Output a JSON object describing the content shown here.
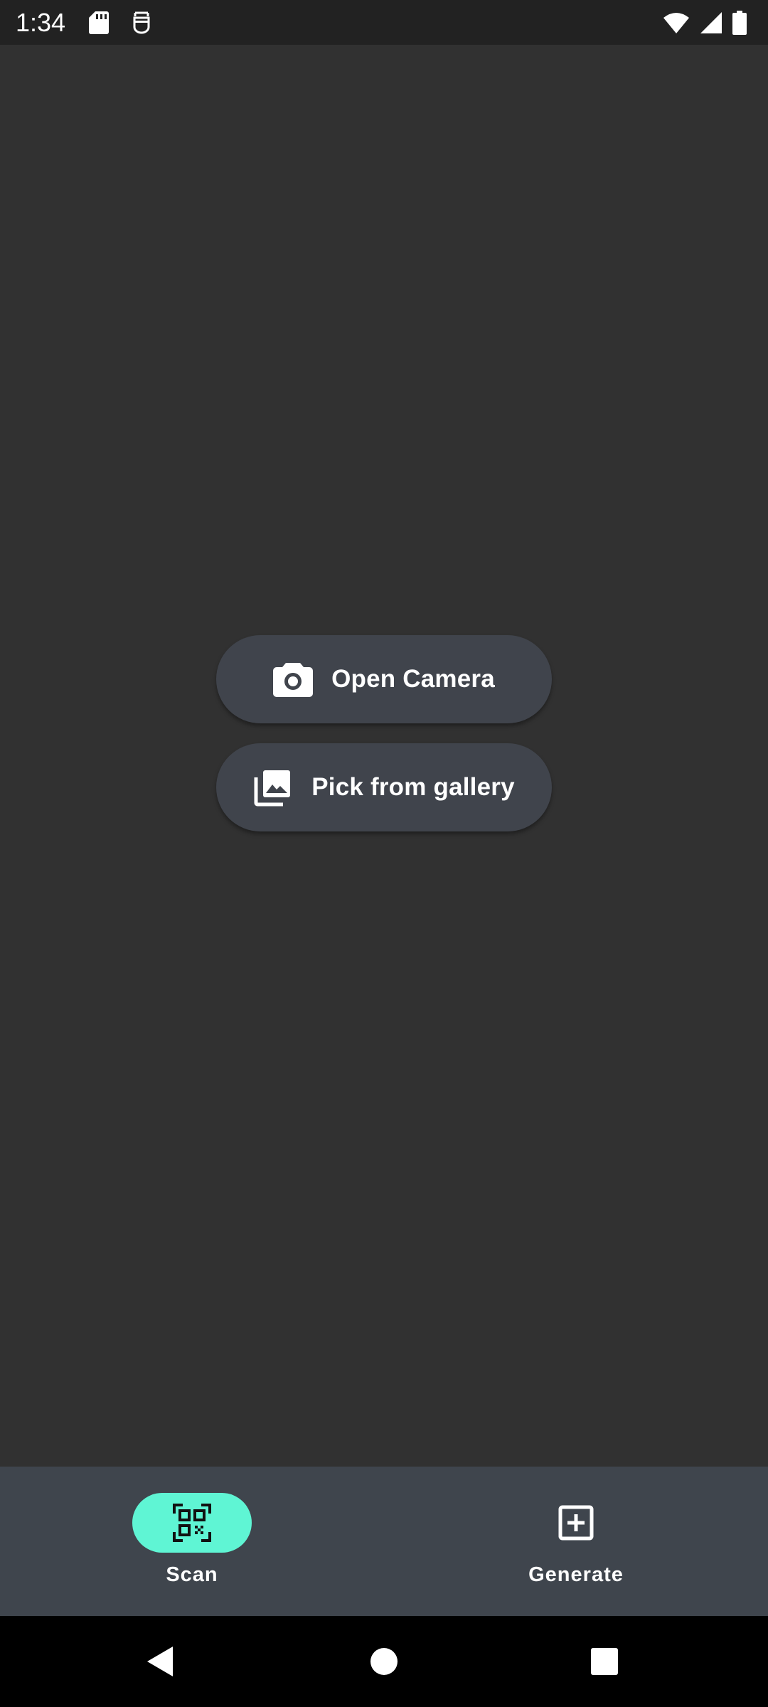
{
  "status_bar": {
    "time": "1:34",
    "left_icons": [
      "sd-card-icon",
      "assistant-icon"
    ],
    "right_icons": [
      "wifi-icon",
      "cellular-signal-icon",
      "battery-icon"
    ]
  },
  "main": {
    "open_camera": {
      "label": "Open Camera",
      "icon": "camera-icon"
    },
    "pick_gallery": {
      "label": "Pick from gallery",
      "icon": "photo-library-icon"
    }
  },
  "bottom_nav": {
    "items": [
      {
        "label": "Scan",
        "icon": "qr-code-scanner-icon",
        "active": true
      },
      {
        "label": "Generate",
        "icon": "add-box-icon",
        "active": false
      }
    ]
  },
  "system_nav": {
    "buttons": [
      "back-icon",
      "home-icon",
      "recents-icon"
    ]
  },
  "colors": {
    "background": "#313131",
    "status_bar": "#222222",
    "button_bg": "#40444c",
    "nav_bg": "#3f454d",
    "accent": "#5ff5d4",
    "system_nav": "#000000"
  }
}
